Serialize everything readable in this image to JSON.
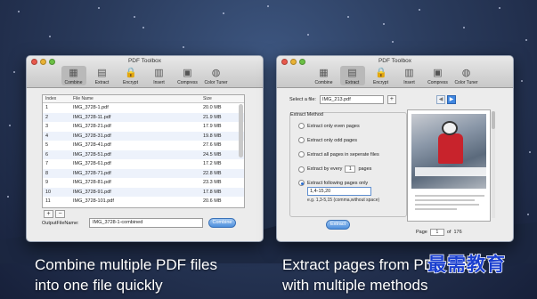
{
  "background": {
    "accent": "#2a3b5c"
  },
  "left_window": {
    "title": "PDF Toolbox",
    "toolbar": [
      {
        "label": "Combine",
        "icon": "combine-icon",
        "glyph": "▦",
        "active": true
      },
      {
        "label": "Extract",
        "icon": "extract-icon",
        "glyph": "▤",
        "active": false
      },
      {
        "label": "Encrypt",
        "icon": "lock-icon",
        "glyph": "🔒",
        "active": false
      },
      {
        "label": "Insert",
        "icon": "insert-icon",
        "glyph": "▥",
        "active": false
      },
      {
        "label": "Compress",
        "icon": "compress-icon",
        "glyph": "▣",
        "active": false
      },
      {
        "label": "Color Tuner",
        "icon": "color-wheel-icon",
        "glyph": "◍",
        "active": false
      }
    ],
    "table": {
      "headers": {
        "index": "Index",
        "name": "File Name",
        "size": "Size"
      },
      "rows": [
        {
          "index": "1",
          "name": "IMG_3728-1.pdf",
          "size": "20.0 MB"
        },
        {
          "index": "2",
          "name": "IMG_3728-11.pdf",
          "size": "21.9 MB"
        },
        {
          "index": "3",
          "name": "IMG_3728-21.pdf",
          "size": "17.9 MB"
        },
        {
          "index": "4",
          "name": "IMG_3728-31.pdf",
          "size": "19.8 MB"
        },
        {
          "index": "5",
          "name": "IMG_3728-41.pdf",
          "size": "27.6 MB"
        },
        {
          "index": "6",
          "name": "IMG_3728-51.pdf",
          "size": "24.5 MB"
        },
        {
          "index": "7",
          "name": "IMG_3728-61.pdf",
          "size": "17.2 MB"
        },
        {
          "index": "8",
          "name": "IMG_3728-71.pdf",
          "size": "22.8 MB"
        },
        {
          "index": "9",
          "name": "IMG_3728-81.pdf",
          "size": "23.3 MB"
        },
        {
          "index": "10",
          "name": "IMG_3728-91.pdf",
          "size": "17.8 MB"
        },
        {
          "index": "11",
          "name": "IMG_3728-101.pdf",
          "size": "20.6 MB"
        }
      ]
    },
    "add_label": "+",
    "remove_label": "−",
    "output_label": "OutputFileName:",
    "output_value": "IMG_3728-1-combined",
    "combine_button": "Combine"
  },
  "right_window": {
    "title": "PDF Toolbox",
    "toolbar": [
      {
        "label": "Combine",
        "icon": "combine-icon",
        "glyph": "▦",
        "active": false
      },
      {
        "label": "Extract",
        "icon": "extract-icon",
        "glyph": "▤",
        "active": true
      },
      {
        "label": "Encrypt",
        "icon": "lock-icon",
        "glyph": "🔒",
        "active": false
      },
      {
        "label": "Insert",
        "icon": "insert-icon",
        "glyph": "▥",
        "active": false
      },
      {
        "label": "Compress",
        "icon": "compress-icon",
        "glyph": "▣",
        "active": false
      },
      {
        "label": "Color Tuner",
        "icon": "color-wheel-icon",
        "glyph": "◍",
        "active": false
      }
    ],
    "select_label": "Select a file:",
    "file_value": "IMG_213.pdf",
    "add_label": "+",
    "prev_label": "◀",
    "next_label": "▶",
    "method_title": "Extract Method",
    "options": [
      {
        "label": "Extract only even pages",
        "selected": false
      },
      {
        "label": "Extract only odd pages",
        "selected": false
      },
      {
        "label": "Extract all pages in seperate files",
        "selected": false
      },
      {
        "label": "Extract by every",
        "selected": false
      },
      {
        "label": "Extract following pages only",
        "selected": true
      }
    ],
    "every_value": "1",
    "every_suffix": "pages",
    "pages_value": "1,4-15,20",
    "example": "e.g. 1,3-5,15 (comma,without space)",
    "extract_button": "Extract",
    "pager_label": "Page",
    "page_value": "1",
    "of_label": "of",
    "total_pages": "176"
  },
  "captions": {
    "left_line1": "Combine multiple PDF files",
    "left_line2": "into one file quickly",
    "right_line1": "Extract pages from PDF file",
    "right_line2": "with multiple methods"
  },
  "watermark": "最需教育"
}
